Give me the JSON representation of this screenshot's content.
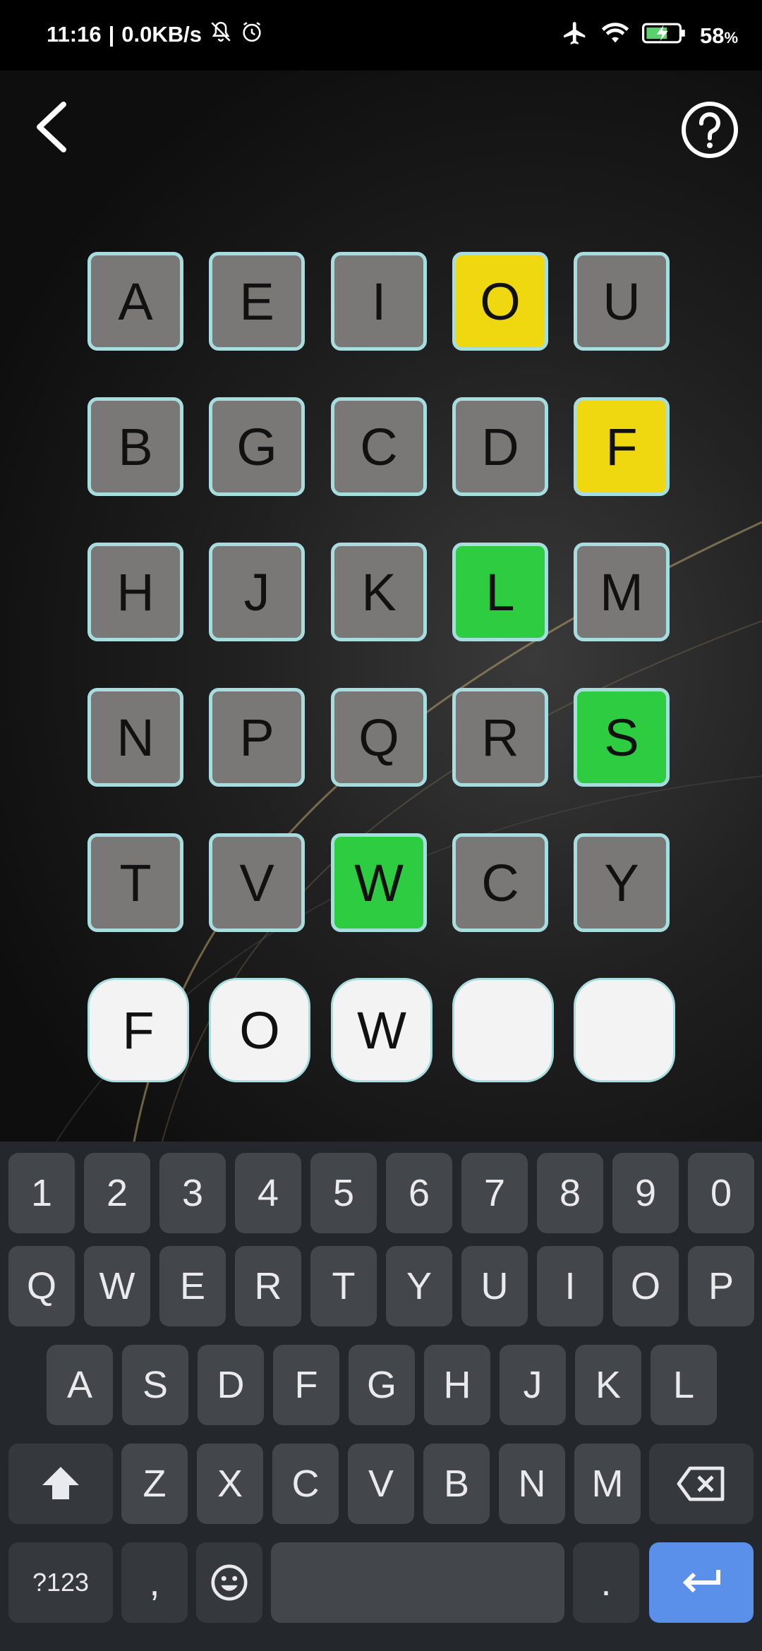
{
  "status_bar": {
    "time": "11:16",
    "network_speed": "0.0KB/s",
    "battery": "58",
    "battery_unit": "%"
  },
  "header": {
    "back_icon": "chevron-left-icon",
    "help_icon": "help-circle-icon"
  },
  "grid": {
    "rows": [
      [
        {
          "letter": "A",
          "state": "gray"
        },
        {
          "letter": "E",
          "state": "gray"
        },
        {
          "letter": "I",
          "state": "gray"
        },
        {
          "letter": "O",
          "state": "yellow"
        },
        {
          "letter": "U",
          "state": "gray"
        }
      ],
      [
        {
          "letter": "B",
          "state": "gray"
        },
        {
          "letter": "G",
          "state": "gray"
        },
        {
          "letter": "C",
          "state": "gray"
        },
        {
          "letter": "D",
          "state": "gray"
        },
        {
          "letter": "F",
          "state": "yellow"
        }
      ],
      [
        {
          "letter": "H",
          "state": "gray"
        },
        {
          "letter": "J",
          "state": "gray"
        },
        {
          "letter": "K",
          "state": "gray"
        },
        {
          "letter": "L",
          "state": "green"
        },
        {
          "letter": "M",
          "state": "gray"
        }
      ],
      [
        {
          "letter": "N",
          "state": "gray"
        },
        {
          "letter": "P",
          "state": "gray"
        },
        {
          "letter": "Q",
          "state": "gray"
        },
        {
          "letter": "R",
          "state": "gray"
        },
        {
          "letter": "S",
          "state": "green"
        }
      ],
      [
        {
          "letter": "T",
          "state": "gray"
        },
        {
          "letter": "V",
          "state": "gray"
        },
        {
          "letter": "W",
          "state": "green"
        },
        {
          "letter": "C",
          "state": "gray"
        },
        {
          "letter": "Y",
          "state": "gray"
        }
      ]
    ]
  },
  "answer": [
    "F",
    "O",
    "W",
    "",
    ""
  ],
  "colors": {
    "tile_gray": "#7a7876",
    "tile_yellow": "#f0d810",
    "tile_green": "#2ecc40",
    "tile_border": "#a8dde0",
    "enter_key": "#5a8fea"
  },
  "keyboard": {
    "number_row": [
      "1",
      "2",
      "3",
      "4",
      "5",
      "6",
      "7",
      "8",
      "9",
      "0"
    ],
    "row1": [
      "Q",
      "W",
      "E",
      "R",
      "T",
      "Y",
      "U",
      "I",
      "O",
      "P"
    ],
    "row2": [
      "A",
      "S",
      "D",
      "F",
      "G",
      "H",
      "J",
      "K",
      "L"
    ],
    "row3": [
      "Z",
      "X",
      "C",
      "V",
      "B",
      "N",
      "M"
    ],
    "symbols_label": "?123",
    "comma": ",",
    "period": ".",
    "shift_icon": "shift-icon",
    "backspace_icon": "backspace-icon",
    "emoji_icon": "emoji-icon",
    "enter_icon": "enter-icon"
  }
}
